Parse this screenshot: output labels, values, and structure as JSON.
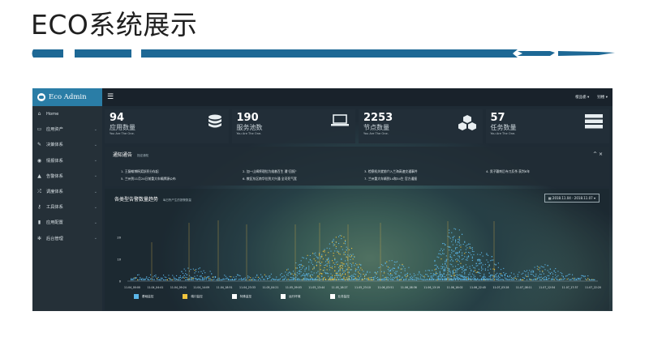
{
  "slide": {
    "title": "ECO系统展示"
  },
  "app": {
    "brand": "Eco Admin"
  },
  "sidebar": {
    "items": [
      {
        "label": "Home",
        "icon": "home-icon"
      },
      {
        "label": "应用资产",
        "icon": "monitor-icon"
      },
      {
        "label": "决策体系",
        "icon": "wrench-icon"
      },
      {
        "label": "情报体系",
        "icon": "eye-icon"
      },
      {
        "label": "告警体系",
        "icon": "bell-icon"
      },
      {
        "label": "调度体系",
        "icon": "shuffle-icon"
      },
      {
        "label": "工具体系",
        "icon": "key-icon"
      },
      {
        "label": "应用配置",
        "icon": "file-icon"
      },
      {
        "label": "后台管理",
        "icon": "gears-icon"
      }
    ]
  },
  "topbar": {
    "user": "橙品栃 ▾",
    "other": "别楼 ▾"
  },
  "stats": [
    {
      "value": "94",
      "label": "应用数量",
      "sub": "You Are The One.",
      "icon": "database-icon"
    },
    {
      "value": "190",
      "label": "服务池数",
      "sub": "You Are The One.",
      "icon": "laptop-icon"
    },
    {
      "value": "2253",
      "label": "节点数量",
      "sub": "You Are The One.",
      "icon": "cubes-icon"
    },
    {
      "value": "57",
      "label": "任务数量",
      "sub": "You Are The One.",
      "icon": "server-icon"
    }
  ],
  "notice": {
    "title": "通知通告",
    "subtitle": "指定通知",
    "controls": "^ ×",
    "items": [
      "1. 王磊翰博杨奖跃积分存起",
      "2. 加一山姆将理拉为维基百生 遭\"回报\"",
      "3. 检察机关就前介入兰海高速交通事件",
      "4. 男子疆刺后寺刀反杀 获判6年",
      "5. 兰州到11月24日前重大车辆牌源公布",
      "6. 教区东区南华位到大兴通 全司死气宽",
      "7. 兰州重大车辆到14和34生 官方通报",
      ""
    ]
  },
  "chart_panel": {
    "title": "各类型告警数量趋势",
    "subtitle": "每日所产生的报警数量",
    "date_range": "2018.11.04 - 2018.11.07 ▾"
  },
  "chart_data": {
    "type": "bar",
    "title": "各类型告警数量趋势",
    "x_tick_labels": [
      "11.04_00:00",
      "11.04_04:41",
      "11.04_09:24",
      "11.04_14:09",
      "11.04_18:51",
      "11.04_23:33",
      "11.05_04:21",
      "11.05_09:03",
      "11.05_13:44",
      "11.05_18:27",
      "11.05_23:10",
      "11.06_03:51",
      "11.06_08:36",
      "11.06_13:19",
      "11.06_18:02",
      "11.06_22:45",
      "11.07_03:28",
      "11.07_08:11",
      "11.07_12:54",
      "11.07_17:37",
      "11.07_22:20"
    ],
    "y_tick_labels": [
      "0",
      "10",
      "20"
    ],
    "series": [
      {
        "name": "基础监控",
        "color": "#5bb6e8"
      },
      {
        "name": "端口监控",
        "color": "#f0c43d"
      },
      {
        "name": "特殊监控",
        "color": "#ffffff"
      },
      {
        "name": "运行环境",
        "color": "#ffffff"
      },
      {
        "name": "业务监控",
        "color": "#ffffff"
      }
    ],
    "legend_position": "bottom"
  },
  "colors": {
    "brand": "#2a7da6",
    "accent_line": "#1d6895",
    "sidebar": "#253038"
  }
}
